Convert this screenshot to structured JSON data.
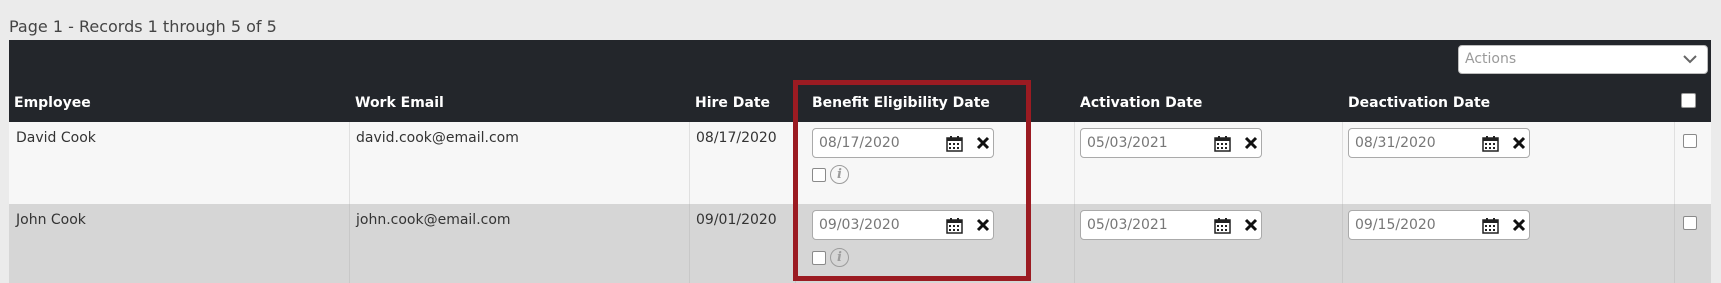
{
  "page_info": "Page 1 - Records 1 through 5 of 5",
  "actions": {
    "placeholder": "Actions",
    "icon": "chevron-down-icon"
  },
  "columns": [
    "Employee",
    "Work Email",
    "Hire Date",
    "Benefit Eligibility Date",
    "Activation Date",
    "Deactivation Date"
  ],
  "rows": [
    {
      "employee": "David Cook",
      "email": "david.cook@email.com",
      "hire_date": "08/17/2020",
      "benefit_date": "08/17/2020",
      "activation_date": "05/03/2021",
      "deactivation_date": "08/31/2020"
    },
    {
      "employee": "John Cook",
      "email": "john.cook@email.com",
      "hire_date": "09/01/2020",
      "benefit_date": "09/03/2020",
      "activation_date": "05/03/2021",
      "deactivation_date": "09/15/2020"
    }
  ],
  "colors": {
    "header_bg": "#23262b",
    "highlight": "#9b1b22",
    "row_alt": "#d6d6d6"
  }
}
